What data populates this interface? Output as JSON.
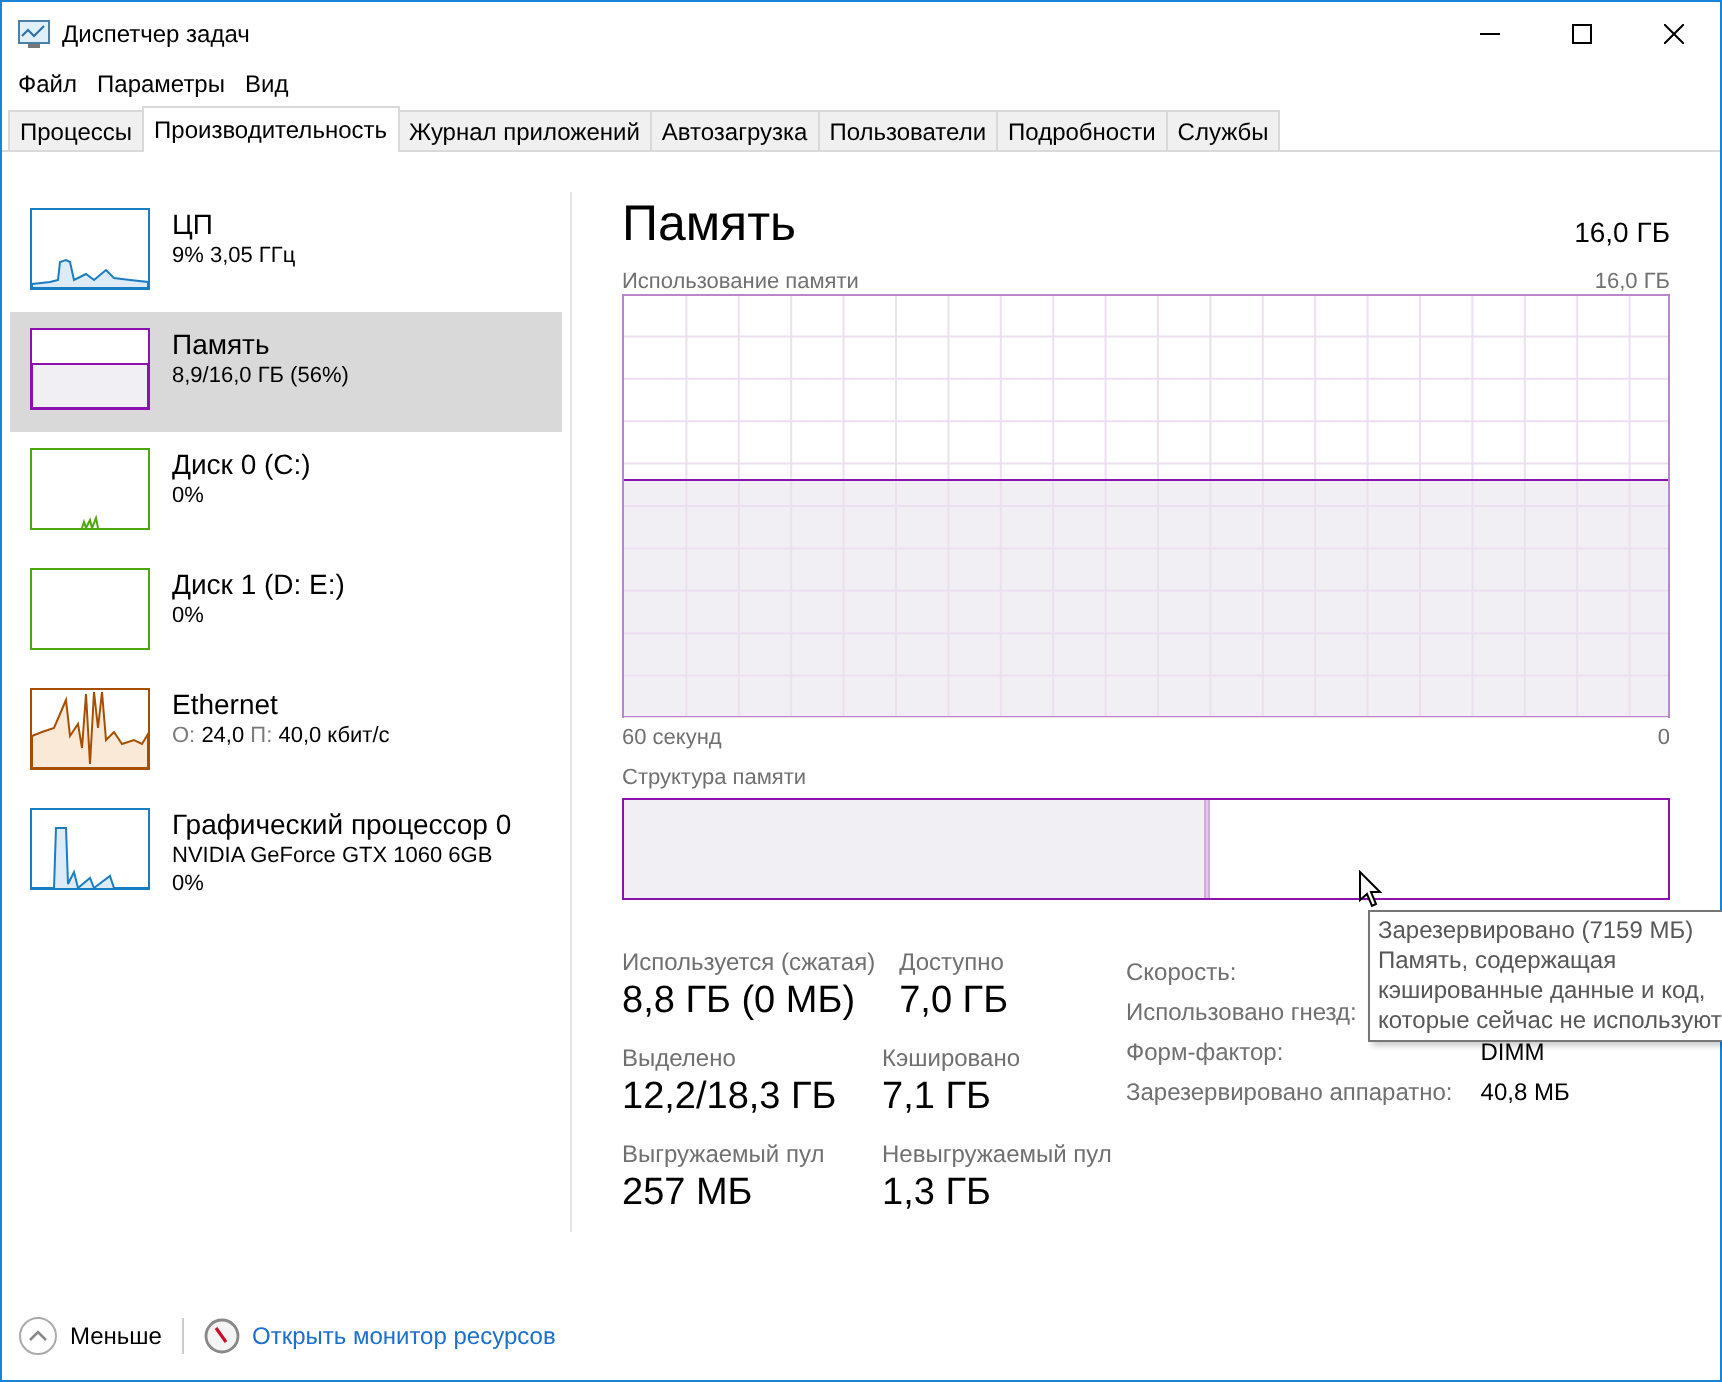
{
  "window": {
    "title": "Диспетчер задач"
  },
  "menu": [
    "Файл",
    "Параметры",
    "Вид"
  ],
  "tabs": [
    {
      "label": "Процессы",
      "selected": false
    },
    {
      "label": "Производительность",
      "selected": true
    },
    {
      "label": "Журнал приложений",
      "selected": false
    },
    {
      "label": "Автозагрузка",
      "selected": false
    },
    {
      "label": "Пользователи",
      "selected": false
    },
    {
      "label": "Подробности",
      "selected": false
    },
    {
      "label": "Службы",
      "selected": false
    }
  ],
  "sidebar": {
    "items": [
      {
        "kind": "cpu",
        "title": "ЦП",
        "color": "#1a7dc4",
        "selected": false,
        "lines": [
          "9%  3,05 ГГц"
        ]
      },
      {
        "kind": "memory",
        "title": "Память",
        "color": "#8b12ae",
        "selected": true,
        "lines": [
          "8,9/16,0 ГБ (56%)"
        ]
      },
      {
        "kind": "disk",
        "title": "Диск 0 (C:)",
        "color": "#4da60c",
        "selected": false,
        "lines": [
          "0%"
        ]
      },
      {
        "kind": "idle",
        "title": "Диск 1 (D: E:)",
        "color": "#4da60c",
        "selected": false,
        "lines": [
          "0%"
        ]
      },
      {
        "kind": "network",
        "title": "Ethernet",
        "color": "#a74f01",
        "selected": false,
        "stats": [
          {
            "label": "О:",
            "value": "24,0"
          },
          {
            "label": "П:",
            "value": "40,0 кбит/с"
          }
        ]
      },
      {
        "kind": "gpu",
        "title": "Графический процессор 0",
        "color": "#1a7dc4",
        "selected": false,
        "lines": [
          "NVIDIA GeForce GTX 1060 6GB",
          "0%"
        ]
      }
    ]
  },
  "main": {
    "title": "Память",
    "total": "16,0 ГБ",
    "usage_graph": {
      "label": "Использование памяти",
      "max": "16,0 ГБ",
      "time": "60 секунд",
      "min": "0"
    },
    "composition": {
      "label": "Структура памяти",
      "segments": [
        {
          "level": 0.555
        },
        {
          "level": 0.006
        }
      ]
    },
    "stats": [
      [
        {
          "label": "Используется (сжатая)",
          "value": "8,8 ГБ (0 МБ)"
        },
        {
          "label": "Доступно",
          "value": "7,0 ГБ"
        }
      ],
      [
        {
          "label": "Выделено",
          "value": "12,2/18,3 ГБ"
        },
        {
          "label": "Кэшировано",
          "value": "7,1 ГБ"
        }
      ],
      [
        {
          "label": "Выгружаемый пул",
          "value": "257 МБ"
        },
        {
          "label": "Невыгружаемый пул",
          "value": "1,3 ГБ"
        }
      ]
    ],
    "details": [
      {
        "label": "Скорость:"
      },
      {
        "label": "Использовано гнезд:"
      },
      {
        "label": "Форм-фактор:",
        "value": "DIMM"
      },
      {
        "label": "Зарезервировано аппаратно:",
        "value": "40,8 МБ"
      }
    ],
    "tooltip": {
      "title": "Зарезервировано (7159 МБ)",
      "lines": [
        "Память, содержащая",
        "кэшированные данные и код,",
        "которые сейчас не используют"
      ]
    }
  },
  "footer": {
    "less": "Меньше",
    "link": "Открыть монитор ресурсов"
  }
}
